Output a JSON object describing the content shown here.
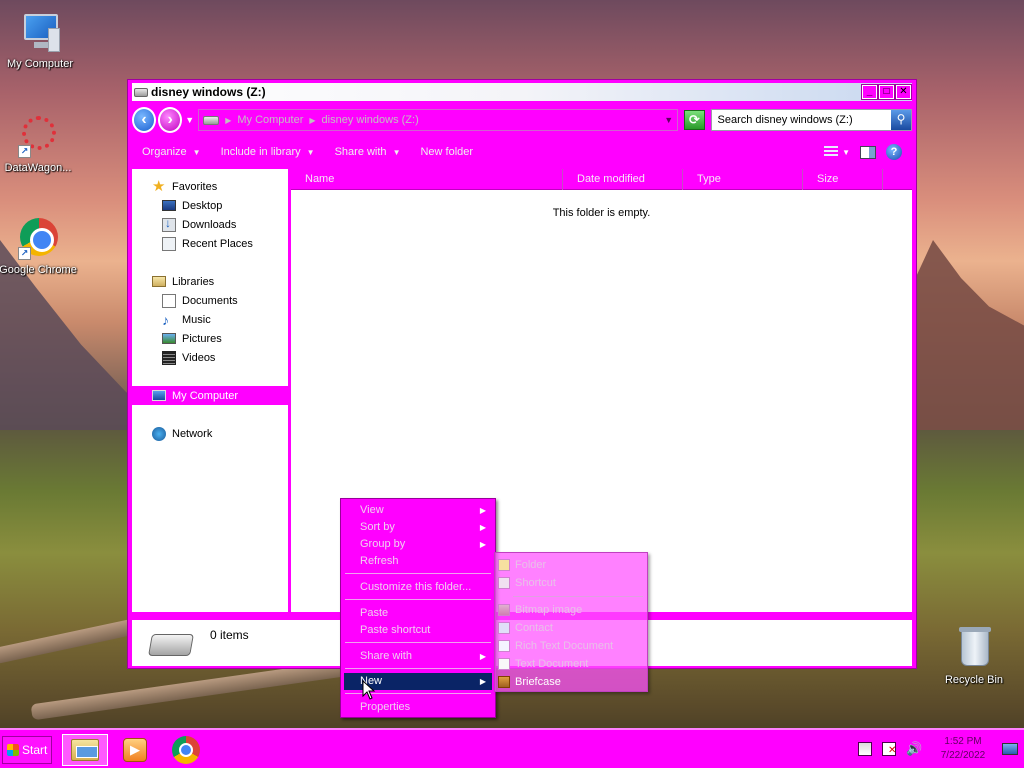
{
  "desktop": {
    "icons": [
      {
        "label": "My Computer",
        "icon": "computer-icon"
      },
      {
        "label": "DataWagon...",
        "icon": "datawagon-icon"
      },
      {
        "label": "Google Chrome",
        "icon": "chrome-icon"
      },
      {
        "label": "Recycle Bin",
        "icon": "recycle-bin-icon"
      }
    ]
  },
  "window": {
    "title": "disney windows (Z:)",
    "controls": {
      "minimize": "_",
      "maximize": "□",
      "close": "✕"
    }
  },
  "address": {
    "breadcrumbs": [
      "My Computer",
      "disney windows (Z:)"
    ],
    "search_placeholder": "Search disney windows (Z:)"
  },
  "toolbar": {
    "organize": "Organize",
    "include_in_library": "Include in library",
    "share_with": "Share with",
    "new_folder": "New folder"
  },
  "nav_pane": {
    "favorites": "Favorites",
    "desktop": "Desktop",
    "downloads": "Downloads",
    "recent_places": "Recent Places",
    "libraries": "Libraries",
    "documents": "Documents",
    "music": "Music",
    "pictures": "Pictures",
    "videos": "Videos",
    "my_computer": "My Computer",
    "network": "Network"
  },
  "columns": [
    "Name",
    "Date modified",
    "Type",
    "Size"
  ],
  "content": {
    "empty_message": "This folder is empty."
  },
  "details": {
    "items_count": "0 items"
  },
  "context_menu": {
    "view": "View",
    "sort_by": "Sort by",
    "group_by": "Group by",
    "refresh": "Refresh",
    "customize": "Customize this folder...",
    "paste": "Paste",
    "paste_shortcut": "Paste shortcut",
    "share_with": "Share with",
    "new": "New",
    "properties": "Properties"
  },
  "new_submenu": {
    "folder": "Folder",
    "shortcut": "Shortcut",
    "bitmap": "Bitmap image",
    "contact": "Contact",
    "rtf": "Rich Text Document",
    "txt": "Text Document",
    "briefcase": "Briefcase"
  },
  "taskbar": {
    "start_label": "Start",
    "time": "1:52 PM",
    "date": "7/22/2022"
  },
  "colors": {
    "window_chrome": "#ff00ff",
    "menu_highlight": "#0a2466"
  }
}
